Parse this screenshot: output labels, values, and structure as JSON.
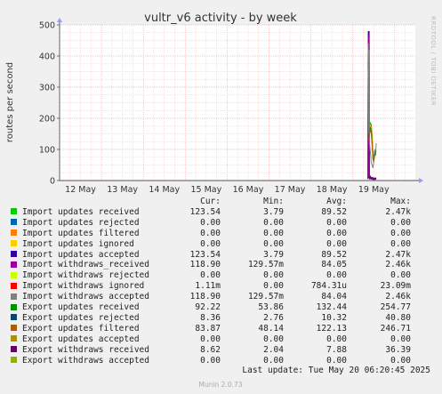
{
  "chart_data": {
    "type": "line",
    "title": "vultr_v6 activity - by week",
    "ylabel": "routes per second",
    "ylim": [
      0,
      500
    ],
    "yticks": [
      0,
      100,
      200,
      300,
      400,
      500
    ],
    "x_categories": [
      "12 May",
      "13 May",
      "14 May",
      "15 May",
      "16 May",
      "17 May",
      "18 May",
      "19 May"
    ],
    "grid": true,
    "series": [
      {
        "name": "Import updates received",
        "color": "#00cc00",
        "points": [
          [
            7.38,
            160
          ],
          [
            7.4,
            170
          ],
          [
            7.42,
            185
          ],
          [
            7.44,
            180
          ],
          [
            7.46,
            150
          ],
          [
            7.48,
            90
          ],
          [
            7.5,
            70
          ],
          [
            7.52,
            95
          ],
          [
            7.54,
            100
          ],
          [
            7.56,
            98
          ]
        ]
      },
      {
        "name": "Import updates rejected",
        "color": "#0066b3",
        "points": []
      },
      {
        "name": "Import updates filtered",
        "color": "#ff8000",
        "points": [
          [
            7.38,
            150
          ],
          [
            7.4,
            160
          ],
          [
            7.42,
            175
          ],
          [
            7.44,
            170
          ],
          [
            7.46,
            140
          ],
          [
            7.48,
            80
          ],
          [
            7.5,
            65
          ],
          [
            7.52,
            85
          ],
          [
            7.54,
            90
          ],
          [
            7.56,
            88
          ]
        ]
      },
      {
        "name": "Import updates ignored",
        "color": "#ffcc00",
        "points": []
      },
      {
        "name": "Import updates accepted",
        "color": "#330099",
        "points": [
          [
            7.36,
            5
          ],
          [
            7.37,
            480
          ],
          [
            7.38,
            8
          ],
          [
            7.39,
            480
          ],
          [
            7.4,
            6
          ],
          [
            7.42,
            8
          ],
          [
            7.44,
            5
          ],
          [
            7.46,
            6
          ],
          [
            7.48,
            4
          ],
          [
            7.5,
            5
          ],
          [
            7.52,
            4
          ],
          [
            7.54,
            5
          ],
          [
            7.56,
            6
          ]
        ]
      },
      {
        "name": "Import withdraws_received",
        "color": "#990099",
        "points": [
          [
            7.36,
            5
          ],
          [
            7.37,
            470
          ],
          [
            7.38,
            7
          ],
          [
            7.39,
            460
          ],
          [
            7.4,
            5
          ],
          [
            7.42,
            6
          ],
          [
            7.44,
            4
          ],
          [
            7.46,
            5
          ],
          [
            7.48,
            3
          ],
          [
            7.5,
            4
          ],
          [
            7.52,
            3
          ],
          [
            7.54,
            4
          ],
          [
            7.56,
            5
          ]
        ]
      },
      {
        "name": "Import withdraws rejected",
        "color": "#ccff00",
        "points": []
      },
      {
        "name": "Import withdraws ignored",
        "color": "#ff0000",
        "points": []
      },
      {
        "name": "Import withdraws accepted",
        "color": "#808080",
        "points": [
          [
            7.36,
            360
          ],
          [
            7.37,
            440
          ],
          [
            7.38,
            150
          ],
          [
            7.39,
            420
          ],
          [
            7.4,
            120
          ],
          [
            7.42,
            90
          ],
          [
            7.44,
            60
          ],
          [
            7.46,
            50
          ],
          [
            7.48,
            40
          ],
          [
            7.5,
            60
          ],
          [
            7.52,
            95
          ],
          [
            7.54,
            80
          ],
          [
            7.56,
            120
          ]
        ]
      },
      {
        "name": "Export updates received",
        "color": "#008f00",
        "points": [
          [
            7.38,
            140
          ],
          [
            7.4,
            155
          ],
          [
            7.42,
            170
          ],
          [
            7.44,
            160
          ],
          [
            7.46,
            120
          ],
          [
            7.48,
            70
          ],
          [
            7.5,
            60
          ],
          [
            7.52,
            80
          ],
          [
            7.54,
            92
          ],
          [
            7.56,
            95
          ]
        ]
      },
      {
        "name": "Export updates rejected",
        "color": "#00487d",
        "points": [
          [
            7.38,
            12
          ],
          [
            7.4,
            10
          ],
          [
            7.42,
            14
          ],
          [
            7.44,
            9
          ],
          [
            7.46,
            10
          ],
          [
            7.48,
            8
          ],
          [
            7.5,
            9
          ],
          [
            7.52,
            7
          ],
          [
            7.54,
            8
          ],
          [
            7.56,
            9
          ]
        ]
      },
      {
        "name": "Export updates filtered",
        "color": "#b35a00",
        "points": [
          [
            7.38,
            130
          ],
          [
            7.4,
            150
          ],
          [
            7.42,
            165
          ],
          [
            7.44,
            150
          ],
          [
            7.46,
            115
          ],
          [
            7.48,
            75
          ],
          [
            7.5,
            62
          ],
          [
            7.52,
            78
          ],
          [
            7.54,
            86
          ],
          [
            7.56,
            84
          ]
        ]
      },
      {
        "name": "Export updates accepted",
        "color": "#b38f00",
        "points": []
      },
      {
        "name": "Export withdraws received",
        "color": "#6b006b",
        "points": [
          [
            7.38,
            10
          ],
          [
            7.4,
            9
          ],
          [
            7.42,
            12
          ],
          [
            7.44,
            8
          ],
          [
            7.46,
            9
          ],
          [
            7.48,
            7
          ],
          [
            7.5,
            8
          ],
          [
            7.52,
            6
          ],
          [
            7.54,
            7
          ],
          [
            7.56,
            8
          ]
        ]
      },
      {
        "name": "Export withdraws accepted",
        "color": "#8fb300",
        "points": []
      }
    ]
  },
  "side_label": "RRDTOOL / TOBI OETIKER",
  "legend": {
    "headers": {
      "cur": "Cur:",
      "min": "Min:",
      "avg": "Avg:",
      "max": "Max:"
    },
    "rows": [
      {
        "name": "Import updates received",
        "color": "#00cc00",
        "cur": "123.54",
        "min": "3.79",
        "avg": "89.52",
        "max": "2.47k"
      },
      {
        "name": "Import updates rejected",
        "color": "#0066b3",
        "cur": "0.00",
        "min": "0.00",
        "avg": "0.00",
        "max": "0.00"
      },
      {
        "name": "Import updates filtered",
        "color": "#ff8000",
        "cur": "0.00",
        "min": "0.00",
        "avg": "0.00",
        "max": "0.00"
      },
      {
        "name": "Import updates ignored",
        "color": "#ffcc00",
        "cur": "0.00",
        "min": "0.00",
        "avg": "0.00",
        "max": "0.00"
      },
      {
        "name": "Import updates accepted",
        "color": "#330099",
        "cur": "123.54",
        "min": "3.79",
        "avg": "89.52",
        "max": "2.47k"
      },
      {
        "name": "Import withdraws_received",
        "color": "#990099",
        "cur": "118.90",
        "min": "129.57m",
        "avg": "84.05",
        "max": "2.46k"
      },
      {
        "name": "Import withdraws rejected",
        "color": "#ccff00",
        "cur": "0.00",
        "min": "0.00",
        "avg": "0.00",
        "max": "0.00"
      },
      {
        "name": "Import withdraws ignored",
        "color": "#ff0000",
        "cur": "1.11m",
        "min": "0.00",
        "avg": "784.31u",
        "max": "23.09m"
      },
      {
        "name": "Import withdraws accepted",
        "color": "#808080",
        "cur": "118.90",
        "min": "129.57m",
        "avg": "84.04",
        "max": "2.46k"
      },
      {
        "name": "Export updates received",
        "color": "#008f00",
        "cur": "92.22",
        "min": "53.86",
        "avg": "132.44",
        "max": "254.77"
      },
      {
        "name": "Export updates rejected",
        "color": "#00487d",
        "cur": "8.36",
        "min": "2.76",
        "avg": "10.32",
        "max": "40.80"
      },
      {
        "name": "Export updates filtered",
        "color": "#b35a00",
        "cur": "83.87",
        "min": "48.14",
        "avg": "122.13",
        "max": "246.71"
      },
      {
        "name": "Export updates accepted",
        "color": "#b38f00",
        "cur": "0.00",
        "min": "0.00",
        "avg": "0.00",
        "max": "0.00"
      },
      {
        "name": "Export withdraws received",
        "color": "#6b006b",
        "cur": "8.62",
        "min": "2.04",
        "avg": "7.88",
        "max": "36.39"
      },
      {
        "name": "Export withdraws accepted",
        "color": "#8fb300",
        "cur": "0.00",
        "min": "0.00",
        "avg": "0.00",
        "max": "0.00"
      }
    ]
  },
  "last_update": "Last update: Tue May 20 06:20:45 2025",
  "footer": "Munin 2.0.73"
}
